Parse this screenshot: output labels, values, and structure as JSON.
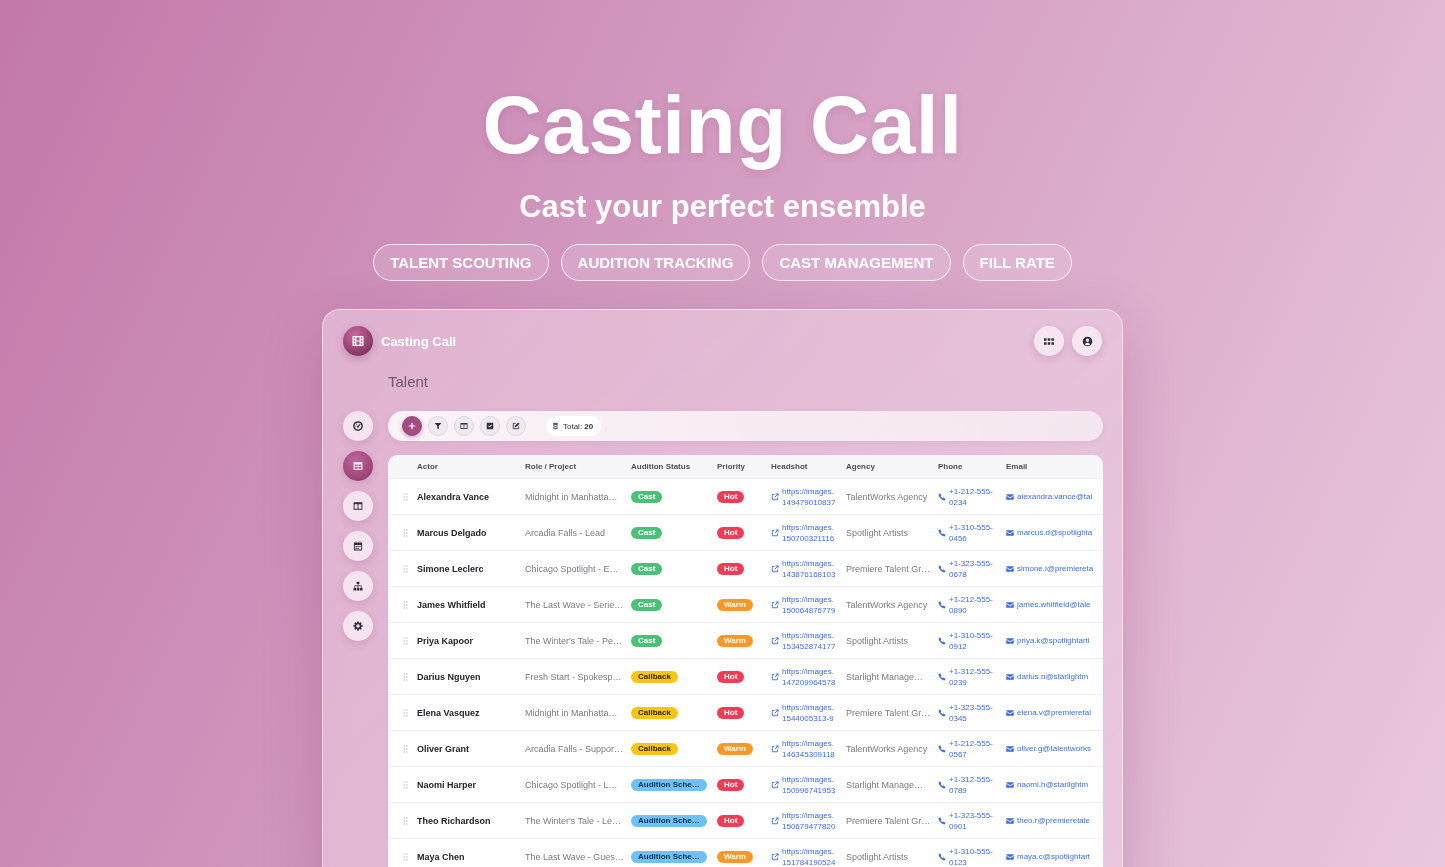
{
  "hero": {
    "title": "Casting Call",
    "subtitle": "Cast your perfect ensemble",
    "tags": [
      "TALENT SCOUTING",
      "AUDITION TRACKING",
      "CAST MANAGEMENT",
      "FILL RATE"
    ]
  },
  "window": {
    "title": "Casting Call"
  },
  "page_title": "Talent",
  "sidebar": {
    "items": [
      {
        "selected": false
      },
      {
        "selected": true
      },
      {
        "selected": false
      },
      {
        "selected": false
      },
      {
        "selected": false
      },
      {
        "selected": false
      }
    ]
  },
  "toolbar": {
    "total": "Total: **20**"
  },
  "table": {
    "columns": [
      "Actor",
      "Role / Project",
      "Audition Status",
      "Priority",
      "Headshot",
      "Agency",
      "Phone",
      "Email"
    ],
    "rows": [
      {
        "actor": "Alexandra Vance",
        "role": "Midnight in Manhatta…",
        "status": {
          "label": "Cast",
          "kind": "cast"
        },
        "priority": {
          "label": "Hot",
          "kind": "hot"
        },
        "headshot": [
          "https://images.",
          "149479010837"
        ],
        "agency": "TalentWorks Agency",
        "phone": [
          "+1-212-555-",
          "0234"
        ],
        "email": "alexandra.vance@tal"
      },
      {
        "actor": "Marcus Delgado",
        "role": "Arcadia Falls - Lead",
        "status": {
          "label": "Cast",
          "kind": "cast"
        },
        "priority": {
          "label": "Hot",
          "kind": "hot"
        },
        "headshot": [
          "https://images.",
          "150700321116"
        ],
        "agency": "Spotlight Artists",
        "phone": [
          "+1-310-555-",
          "0456"
        ],
        "email": "marcus.d@spotlighta"
      },
      {
        "actor": "Simone Leclerc",
        "role": "Chicago Spotlight - E…",
        "status": {
          "label": "Cast",
          "kind": "cast"
        },
        "priority": {
          "label": "Hot",
          "kind": "hot"
        },
        "headshot": [
          "https://images.",
          "143876168103"
        ],
        "agency": "Premiere Talent Gr…",
        "phone": [
          "+1-323-555-",
          "0678"
        ],
        "email": "simone.l@premiereta"
      },
      {
        "actor": "James Whitfield",
        "role": "The Last Wave - Serie…",
        "status": {
          "label": "Cast",
          "kind": "cast"
        },
        "priority": {
          "label": "Warm",
          "kind": "warm"
        },
        "headshot": [
          "https://images.",
          "150064876779"
        ],
        "agency": "TalentWorks Agency",
        "phone": [
          "+1-212-555-",
          "0890"
        ],
        "email": "james.whitfield@tale"
      },
      {
        "actor": "Priya Kapoor",
        "role": "The Winter's Tale - Pe…",
        "status": {
          "label": "Cast",
          "kind": "cast"
        },
        "priority": {
          "label": "Warm",
          "kind": "warm"
        },
        "headshot": [
          "https://images.",
          "153452874177"
        ],
        "agency": "Spotlight Artists",
        "phone": [
          "+1-310-555-",
          "0912"
        ],
        "email": "priya.k@spotlightarti"
      },
      {
        "actor": "Darius Nguyen",
        "role": "Fresh Start - Spokesp…",
        "status": {
          "label": "Callback",
          "kind": "callback"
        },
        "priority": {
          "label": "Hot",
          "kind": "hot"
        },
        "headshot": [
          "https://images.",
          "147209964578"
        ],
        "agency": "Starlight Manage…",
        "phone": [
          "+1-312-555-",
          "0239"
        ],
        "email": "darius.n@starlightm"
      },
      {
        "actor": "Elena Vasquez",
        "role": "Midnight in Manhatta…",
        "status": {
          "label": "Callback",
          "kind": "callback"
        },
        "priority": {
          "label": "Hot",
          "kind": "hot"
        },
        "headshot": [
          "https://images.",
          "1544005313-9"
        ],
        "agency": "Premiere Talent Gr…",
        "phone": [
          "+1-323-555-",
          "0345"
        ],
        "email": "elena.v@premieretal"
      },
      {
        "actor": "Oliver Grant",
        "role": "Arcadia Falls - Suppor…",
        "status": {
          "label": "Callback",
          "kind": "callback"
        },
        "priority": {
          "label": "Warm",
          "kind": "warm"
        },
        "headshot": [
          "https://images.",
          "146345309118"
        ],
        "agency": "TalentWorks Agency",
        "phone": [
          "+1-212-555-",
          "0567"
        ],
        "email": "oliver.g@talentworks"
      },
      {
        "actor": "Naomi Harper",
        "role": "Chicago Spotlight - L…",
        "status": {
          "label": "Audition Sche…",
          "kind": "scheduled"
        },
        "priority": {
          "label": "Hot",
          "kind": "hot"
        },
        "headshot": [
          "https://images.",
          "150996741953"
        ],
        "agency": "Starlight Manage…",
        "phone": [
          "+1-312-555-",
          "0789"
        ],
        "email": "naomi.h@starlightm"
      },
      {
        "actor": "Theo Richardson",
        "role": "The Winter's Tale - Le…",
        "status": {
          "label": "Audition Sche…",
          "kind": "scheduled"
        },
        "priority": {
          "label": "Hot",
          "kind": "hot"
        },
        "headshot": [
          "https://images.",
          "150679477820"
        ],
        "agency": "Premiere Talent Gr…",
        "phone": [
          "+1-323-555-",
          "0901"
        ],
        "email": "theo.r@premieretale"
      },
      {
        "actor": "Maya Chen",
        "role": "The Last Wave - Gues…",
        "status": {
          "label": "Audition Sche…",
          "kind": "scheduled"
        },
        "priority": {
          "label": "Warm",
          "kind": "warm"
        },
        "headshot": [
          "https://images.",
          "151784190524"
        ],
        "agency": "Spotlight Artists",
        "phone": [
          "+1-310-555-",
          "0123"
        ],
        "email": "maya.c@spotlightart"
      }
    ]
  }
}
